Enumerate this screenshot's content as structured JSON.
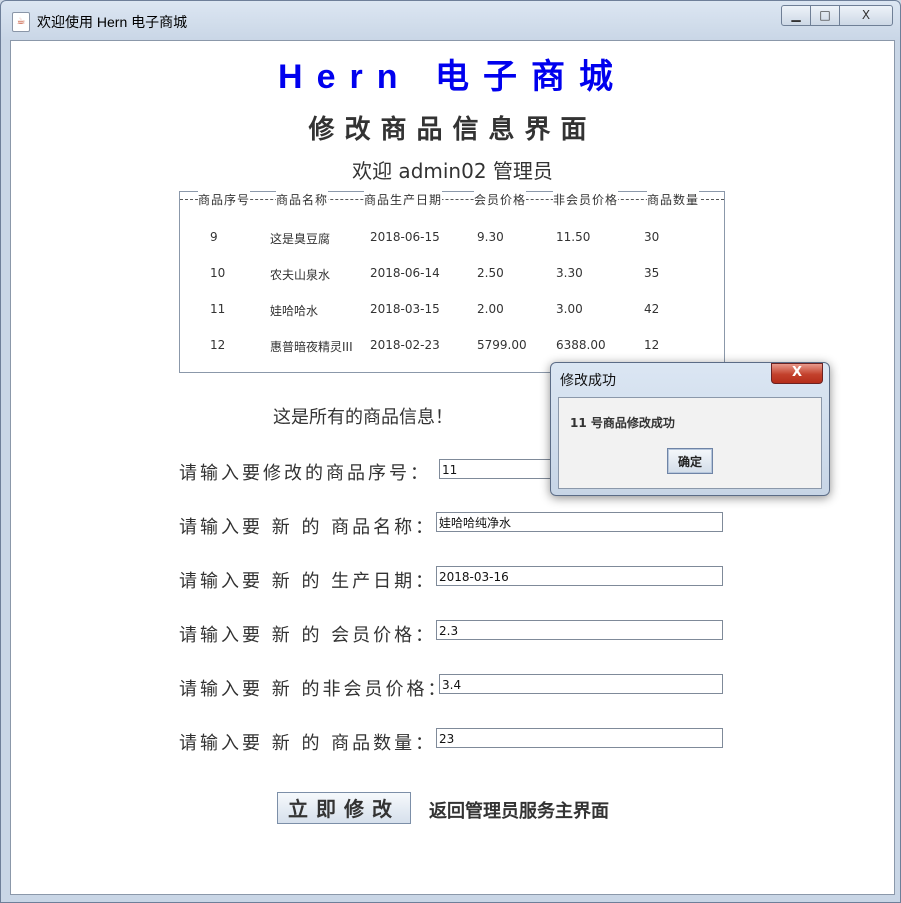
{
  "window": {
    "title": "欢迎使用  Hern  电子商城",
    "controls": {
      "minimize": "▁",
      "maximize": "□",
      "close": "X"
    }
  },
  "header": {
    "brand": "Hern 电子商城",
    "page_title": "修改商品信息界面",
    "welcome": "欢迎  admin02  管理员"
  },
  "table": {
    "columns": [
      "商品序号",
      "商品名称",
      "商品生产日期",
      "会员价格",
      "非会员价格",
      "商品数量"
    ],
    "rows": [
      [
        "9",
        "这是臭豆腐",
        "2018-06-15",
        "9.30",
        "11.50",
        "30"
      ],
      [
        "10",
        "农夫山泉水",
        "2018-06-14",
        "2.50",
        "3.30",
        "35"
      ],
      [
        "11",
        "娃哈哈水",
        "2018-03-15",
        "2.00",
        "3.00",
        "42"
      ],
      [
        "12",
        "惠普暗夜精灵III",
        "2018-02-23",
        "5799.00",
        "6388.00",
        "12"
      ]
    ]
  },
  "info_message": "这是所有的商品信息！",
  "form": {
    "id_label": "请输入要修改的商品序号：",
    "id_value": "11",
    "name_label": "请输入要 新 的 商品名称：",
    "name_value": "娃哈哈纯净水",
    "date_label": "请输入要 新 的 生产日期：",
    "date_value": "2018-03-16",
    "member_price_label": "请输入要 新 的 会员价格：",
    "member_price_value": "2.3",
    "nonmember_price_label": "请输入要 新 的非会员价格：",
    "nonmember_price_value": "3.4",
    "quantity_label": "请输入要 新 的 商品数量：",
    "quantity_value": "23"
  },
  "actions": {
    "submit": "立即修改",
    "back": "返回管理员服务主界面"
  },
  "dialog": {
    "title": "修改成功",
    "close": "X",
    "message": "11 号商品修改成功",
    "ok": "确定"
  }
}
